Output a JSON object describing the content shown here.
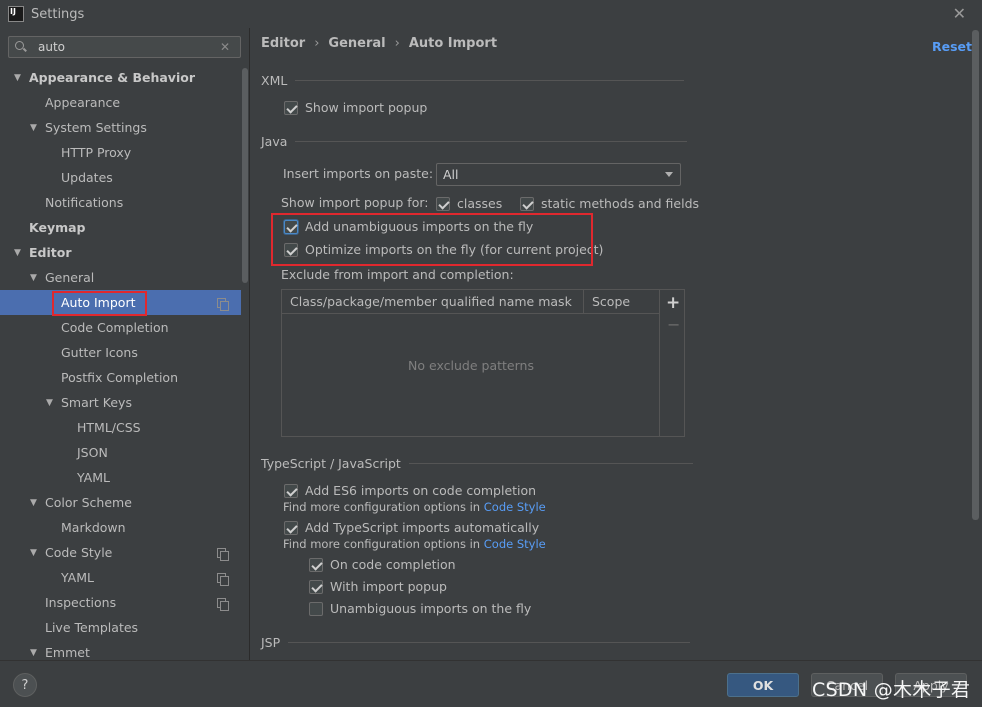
{
  "window": {
    "title": "Settings",
    "logo_text": "IJ"
  },
  "search": {
    "value": "auto"
  },
  "tree": [
    {
      "label": "Appearance & Behavior",
      "level": 0,
      "expanded": true,
      "bold": true
    },
    {
      "label": "Appearance",
      "level": 1
    },
    {
      "label": "System Settings",
      "level": 1,
      "expanded": true
    },
    {
      "label": "HTTP Proxy",
      "level": 2
    },
    {
      "label": "Updates",
      "level": 2
    },
    {
      "label": "Notifications",
      "level": 1
    },
    {
      "label": "Keymap",
      "level": 0,
      "bold": true
    },
    {
      "label": "Editor",
      "level": 0,
      "expanded": true,
      "bold": true
    },
    {
      "label": "General",
      "level": 1,
      "expanded": true
    },
    {
      "label": "Auto Import",
      "level": 2,
      "selected": true,
      "page_icon": true
    },
    {
      "label": "Code Completion",
      "level": 2
    },
    {
      "label": "Gutter Icons",
      "level": 2
    },
    {
      "label": "Postfix Completion",
      "level": 2
    },
    {
      "label": "Smart Keys",
      "level": 2,
      "expanded": true
    },
    {
      "label": "HTML/CSS",
      "level": 3
    },
    {
      "label": "JSON",
      "level": 3
    },
    {
      "label": "YAML",
      "level": 3
    },
    {
      "label": "Color Scheme",
      "level": 1,
      "expanded": true
    },
    {
      "label": "Markdown",
      "level": 2
    },
    {
      "label": "Code Style",
      "level": 1,
      "expanded": true,
      "page_icon": true
    },
    {
      "label": "YAML",
      "level": 2,
      "page_icon": true
    },
    {
      "label": "Inspections",
      "level": 1,
      "page_icon": true
    },
    {
      "label": "Live Templates",
      "level": 1
    },
    {
      "label": "Emmet",
      "level": 1,
      "expanded": true
    }
  ],
  "breadcrumb": [
    "Editor",
    "General",
    "Auto Import"
  ],
  "reset_label": "Reset",
  "xml": {
    "section": "XML",
    "show_import_popup": {
      "label": "Show import popup",
      "checked": true
    }
  },
  "java": {
    "section": "Java",
    "insert_imports_label": "Insert imports on paste:",
    "insert_imports_value": "All",
    "show_popup_for_label": "Show import popup for:",
    "classes": {
      "label": "classes",
      "checked": true
    },
    "static_methods": {
      "label": "static methods and fields",
      "checked": true
    },
    "add_unambiguous": {
      "label": "Add unambiguous imports on the fly",
      "checked": true
    },
    "optimize_imports": {
      "label": "Optimize imports on the fly (for current project)",
      "checked": true
    },
    "exclude_label": "Exclude from import and completion:",
    "table": {
      "col1": "Class/package/member qualified name mask",
      "col2": "Scope",
      "empty": "No exclude patterns"
    }
  },
  "typescript": {
    "section": "TypeScript / JavaScript",
    "es6": {
      "label": "Add ES6 imports on code completion",
      "checked": true
    },
    "more_options_prefix": "Find more configuration options in",
    "code_style_link": "Code Style",
    "ts_auto": {
      "label": "Add TypeScript imports automatically",
      "checked": true
    },
    "on_completion": {
      "label": "On code completion",
      "checked": true
    },
    "with_popup": {
      "label": "With import popup",
      "checked": true
    },
    "unambiguous": {
      "label": "Unambiguous imports on the fly",
      "checked": false
    }
  },
  "jsp": {
    "section": "JSP"
  },
  "buttons": {
    "help": "?",
    "ok": "OK",
    "cancel": "Cancel",
    "apply": "Apply"
  },
  "watermark": "CSDN @木木子君",
  "colors": {
    "selection": "#4b6eaf",
    "link": "#589df6",
    "highlight_border": "#e0282e",
    "ok_button": "#365880"
  }
}
